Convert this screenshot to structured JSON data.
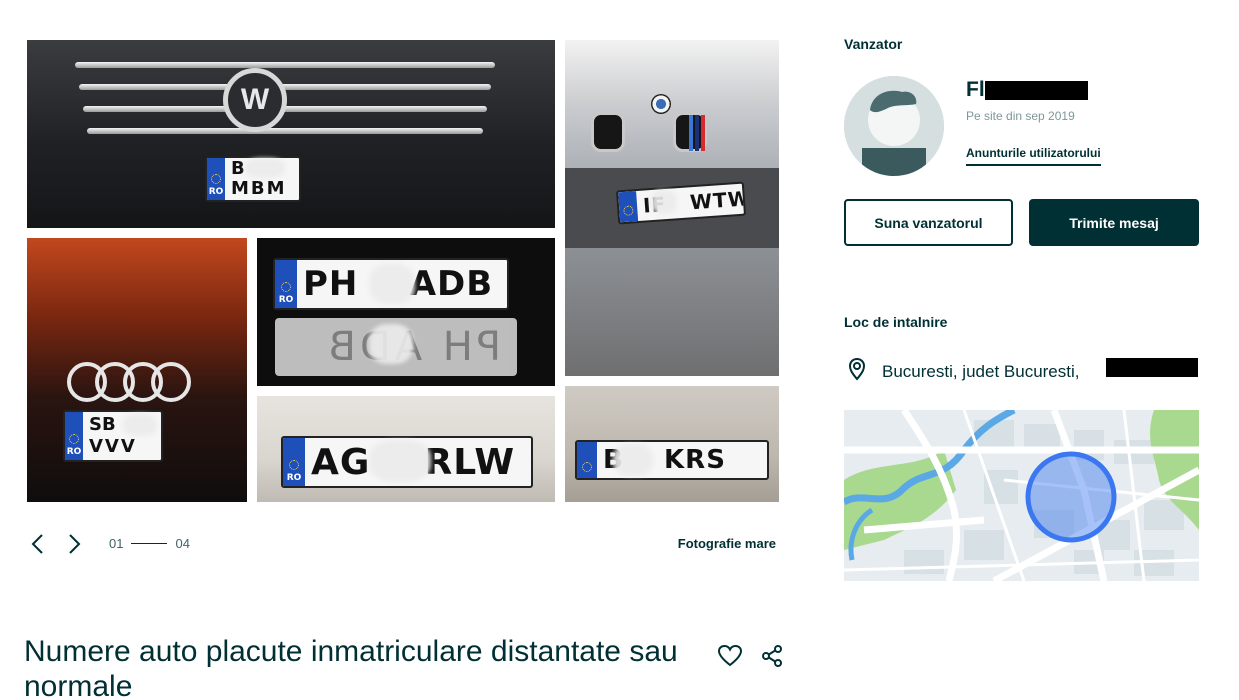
{
  "gallery": {
    "photos": [
      {
        "plate_top": "B",
        "plate_bottom": "MBM",
        "country": "RO"
      },
      {
        "plate": "IF   WTW",
        "country": "RO"
      },
      {
        "plate_top": "SB",
        "plate_bottom": "VVV",
        "country": "RO"
      },
      {
        "plate": "PH    ADB",
        "mirror": "PH    ADB",
        "country": "RO"
      },
      {
        "plate": "AG    RLW",
        "country": "RO"
      },
      {
        "plate": "B    KRS",
        "country": "RO"
      }
    ],
    "counter_current": "01",
    "counter_total": "04",
    "big_photo_label": "Fotografie mare"
  },
  "listing": {
    "title": "Numere auto placute inmatriculare distantate sau normale"
  },
  "seller": {
    "heading": "Vanzator",
    "name": "Fl",
    "since": "Pe site din sep 2019",
    "user_ads_link": "Anunturile utilizatorului",
    "call_button": "Suna vanzatorul",
    "message_button": "Trimite mesaj"
  },
  "meeting": {
    "heading": "Loc de intalnire",
    "location": "Bucuresti, judet Bucuresti,"
  },
  "colors": {
    "primary": "#002f34",
    "map_circle": "#3a77f0",
    "eu_band": "#1f4fb8"
  },
  "icons": {
    "prev": "chevron-left-icon",
    "next": "chevron-right-icon",
    "favorite": "heart-icon",
    "share": "share-icon",
    "location": "map-pin-icon"
  }
}
